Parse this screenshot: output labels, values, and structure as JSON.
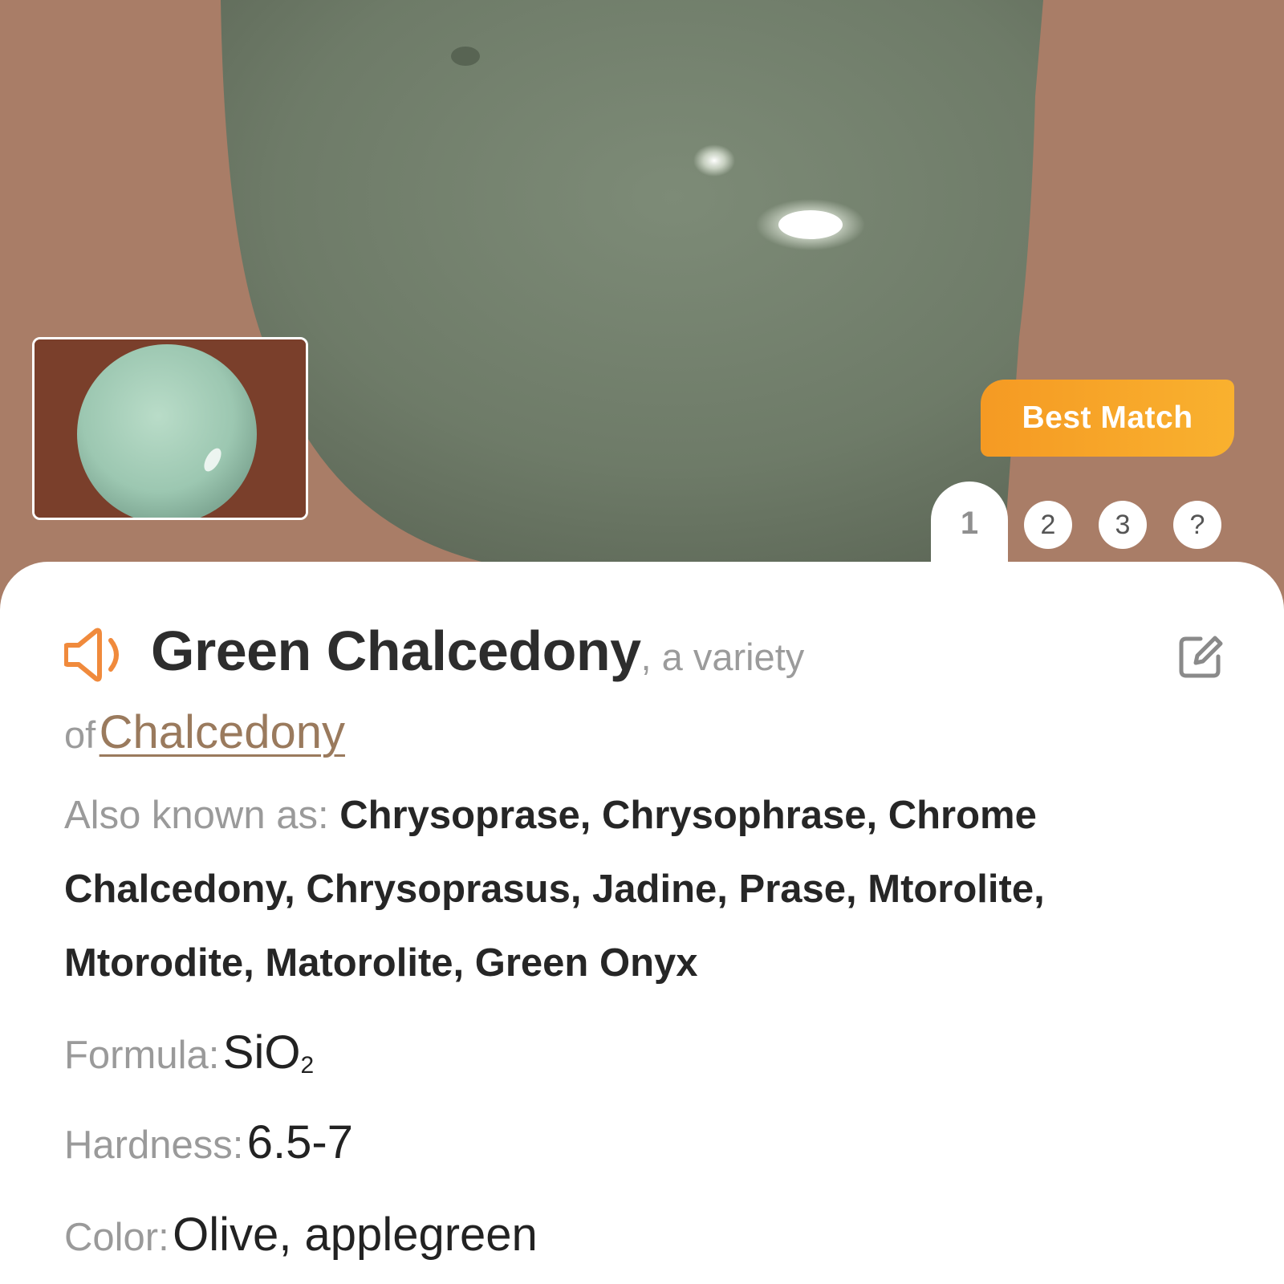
{
  "hero": {
    "badge": "Best Match",
    "tabs": [
      "1",
      "2",
      "3",
      "?"
    ],
    "active_tab": "1"
  },
  "result": {
    "name": "Green Chalcedony",
    "variety_prefix": ", a variety",
    "of_text": "of",
    "parent": "Chalcedony",
    "aka_label": "Also known as:",
    "aka_value": "Chrysoprase, Chrysophrase, Chrome Chalcedony, Chrysoprasus, Jadine, Prase, Mtorolite, Mtorodite, Matorolite, Green Onyx",
    "formula_label": "Formula:",
    "formula_base": "SiO",
    "formula_sub": "2",
    "hardness_label": "Hardness:",
    "hardness_value": "6.5-7",
    "color_label": "Color:",
    "color_value": "Olive, applegreen"
  },
  "icons": {
    "speaker": "speaker-icon",
    "edit": "edit-icon"
  },
  "colors": {
    "accent": "#f59a23",
    "link": "#9a7a5d",
    "background_hero": "#a97d67",
    "stone": "#6f7c6a"
  }
}
